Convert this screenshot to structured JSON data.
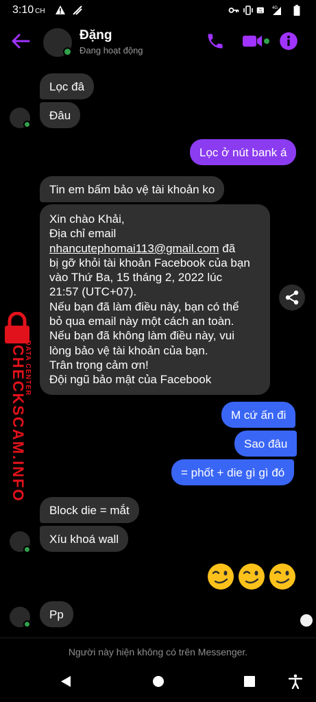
{
  "status_bar": {
    "time": "3:10",
    "time_suffix": "CH",
    "network": "4G"
  },
  "header": {
    "name": "Đặng",
    "status": "Đang hoạt động"
  },
  "messages": {
    "m1": "Lọc đâ",
    "m2": "Đâu",
    "m3": "Lọc ở nút bank á",
    "m4": "Tin em bấm bảo vệ tài khoản ko",
    "m5_lines": [
      "Xin chào Khải,",
      "Địa chỉ email",
      "nhancutephomai113@gmail.com",
      " đã",
      "bị gỡ khỏi tài khoản Facebook của bạn",
      "vào Thứ Ba, 15 tháng 2, 2022 lúc",
      "21:57 (UTC+07).",
      "Nếu bạn đã làm điều này, bạn có thể",
      "bỏ qua email này một cách an toàn.",
      "Nếu bạn đã không làm điều này, vui",
      "lòng bảo vệ tài khoản của bạn.",
      "Trân trọng cảm ơn!",
      "Đội ngũ bảo mật của Facebook"
    ],
    "m6": "M cứ ấn đi",
    "m7": "Sao đâu",
    "m8": "= phốt + die gì gì đó",
    "m9": "Block die = mắt",
    "m10": "Xíu khoá wall",
    "m11": "Pp"
  },
  "footer_note": "Người này hiện không có trên Messenger.",
  "watermark": {
    "brand": "CHECKSCAM.INFO",
    "sub": "DATA CENTER"
  },
  "colors": {
    "accent": "#a033ff",
    "out_bubble_purple": "#8b3cf0",
    "out_bubble_blue": "#3a66f5",
    "in_bubble": "#303030",
    "watermark": "#e1121b"
  },
  "icons": [
    "back-arrow-icon",
    "phone-icon",
    "video-call-icon",
    "info-icon",
    "share-icon",
    "winking-face-emoji",
    "nav-back-icon",
    "nav-home-icon",
    "nav-recents-icon",
    "accessibility-icon"
  ]
}
